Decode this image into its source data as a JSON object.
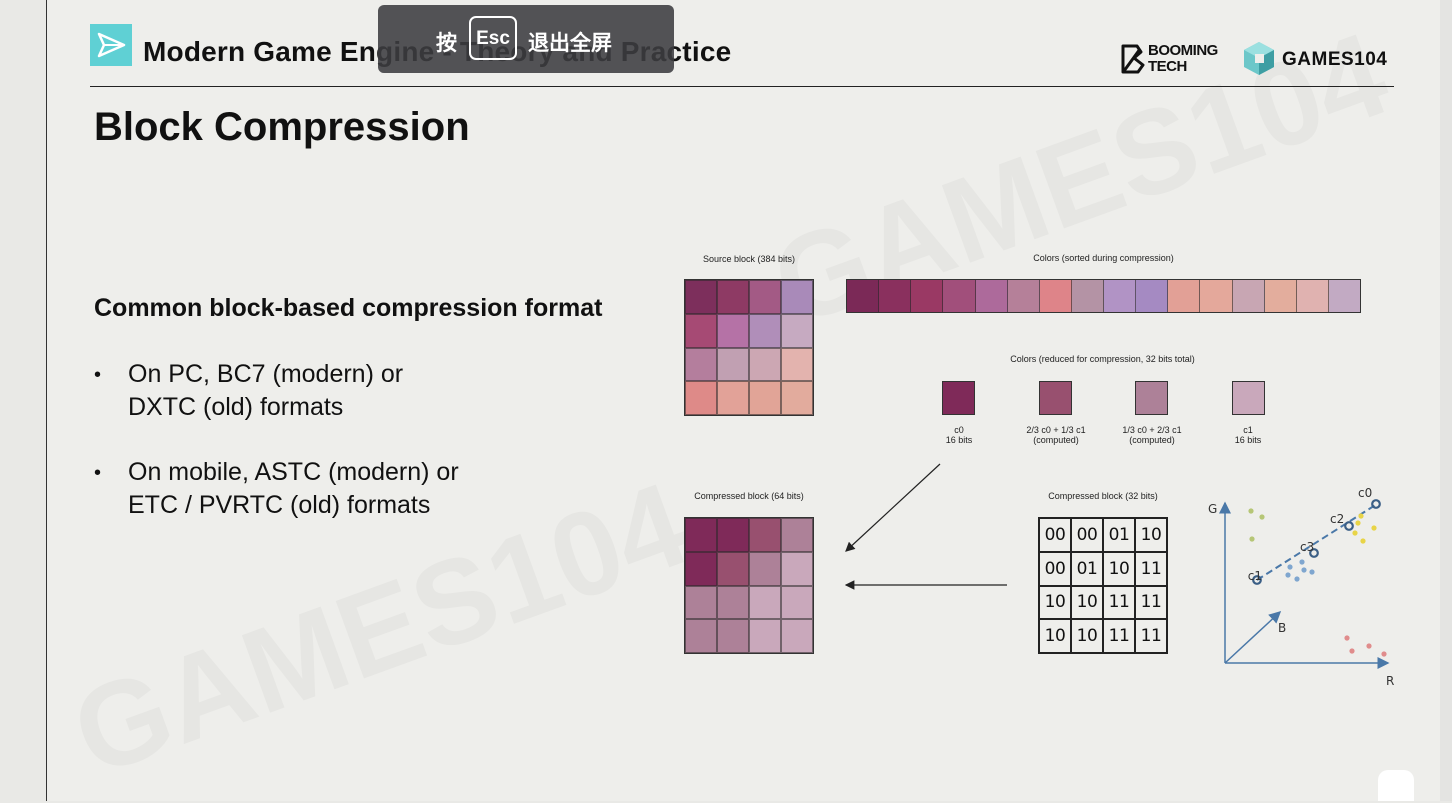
{
  "header": {
    "course_title": "Modern Game Engine - Theory and Practice",
    "brand_booming_line1": "BOOMING",
    "brand_booming_line2": "TECH",
    "brand_games": "GAMES104"
  },
  "esc_overlay": {
    "prefix": "按",
    "key": "Esc",
    "suffix": "退出全屏"
  },
  "slide": {
    "title": "Block Compression",
    "subheading": "Common block-based compression format",
    "bullets": [
      {
        "line1": "On PC,  BC7 (modern) or",
        "line2": "DXTC (old) formats"
      },
      {
        "line1": "On mobile, ASTC (modern) or",
        "line2": "ETC / PVRTC (old) formats"
      }
    ]
  },
  "figure": {
    "source_caption": "Source block (384 bits)",
    "sorted_caption": "Colors (sorted during compression)",
    "reduced_caption": "Colors (reduced for compression, 32 bits total)",
    "compressed64_caption": "Compressed block (64 bits)",
    "compressed32_caption": "Compressed block (32 bits)",
    "palette": [
      {
        "color": "#7f2a59",
        "line1": "c0",
        "line2": "16 bits"
      },
      {
        "color": "#98506f",
        "line1": "2/3 c0 + 1/3 c1",
        "line2": "(computed)"
      },
      {
        "color": "#ad8198",
        "line1": "1/3 c0 + 2/3 c1",
        "line2": "(computed)"
      },
      {
        "color": "#c9a8bb",
        "line1": "c1",
        "line2": "16 bits"
      }
    ],
    "source_colors": [
      [
        "#7d2f5c",
        "#8e3a64",
        "#a35a85",
        "#a98ab9"
      ],
      [
        "#a64a74",
        "#b572a6",
        "#b08eb9",
        "#c6aac1"
      ],
      [
        "#b47e9d",
        "#c1a0b2",
        "#cca7b3",
        "#e3b3ae"
      ],
      [
        "#de8a88",
        "#e2a298",
        "#e1a497",
        "#e2ab9d"
      ]
    ],
    "sorted_colors": [
      "#7b2957",
      "#8a305e",
      "#9a3964",
      "#a14f7b",
      "#ad6a9b",
      "#b58099",
      "#de8489",
      "#b493a5",
      "#b193c5",
      "#a58ac2",
      "#e2a096",
      "#e4a89b",
      "#c8a6b3",
      "#e3ad9d",
      "#e0b2b0",
      "#c2aac3"
    ],
    "compressed_colors": [
      [
        "#7f2a59",
        "#7f2a59",
        "#98506f",
        "#ad8198"
      ],
      [
        "#7f2a59",
        "#98506f",
        "#ad8198",
        "#c9a8bb"
      ],
      [
        "#ad8198",
        "#ad8198",
        "#c9a8bb",
        "#c9a8bb"
      ],
      [
        "#ad8198",
        "#ad8198",
        "#c9a8bb",
        "#c9a8bb"
      ]
    ],
    "bits": [
      [
        "00",
        "00",
        "01",
        "10"
      ],
      [
        "00",
        "01",
        "10",
        "11"
      ],
      [
        "10",
        "10",
        "11",
        "11"
      ],
      [
        "10",
        "10",
        "11",
        "11"
      ]
    ],
    "scatter": {
      "axis_g": "G",
      "axis_b": "B",
      "axis_r": "R",
      "labels": {
        "c0": "c0",
        "c1": "c1",
        "c2": "c2",
        "c3": "c3"
      }
    }
  },
  "watermark_text": "GAMES104"
}
